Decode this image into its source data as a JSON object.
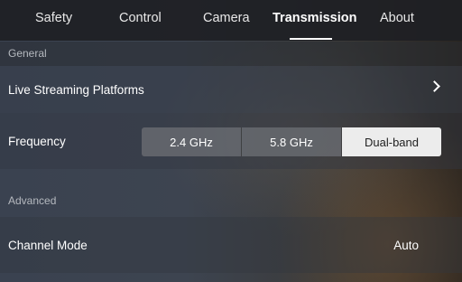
{
  "tabs": [
    {
      "label": "Safety",
      "active": false
    },
    {
      "label": "Control",
      "active": false
    },
    {
      "label": "Camera",
      "active": false
    },
    {
      "label": "Transmission",
      "active": true
    },
    {
      "label": "About",
      "active": false
    }
  ],
  "sections": {
    "general": {
      "header": "General",
      "live_streaming": {
        "label": "Live Streaming Platforms",
        "icon": "chevron-right-icon"
      },
      "frequency": {
        "label": "Frequency",
        "options": [
          "2.4 GHz",
          "5.8 GHz",
          "Dual-band"
        ],
        "selected": "Dual-band"
      }
    },
    "advanced": {
      "header": "Advanced",
      "channel_mode": {
        "label": "Channel Mode",
        "value": "Auto"
      }
    }
  },
  "colors": {
    "accent": "#ffffff",
    "selected_segment": "#ececec",
    "tabbar_bg": "#1e2024"
  }
}
